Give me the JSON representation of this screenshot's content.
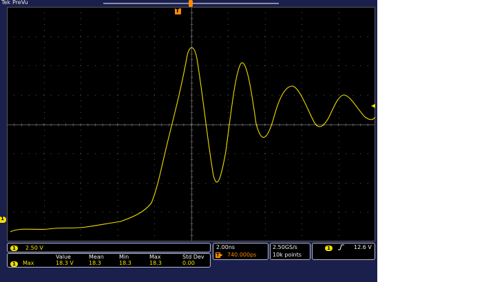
{
  "topbar": {
    "left_icon": "Tek",
    "mode": "PreVu"
  },
  "trigger_marker": "T",
  "channel_marker": "1",
  "scale_panel": {
    "channel": "1",
    "volts_per_div": "2.50 V"
  },
  "measurements": {
    "channel": "1",
    "row_label": "Max",
    "headers": [
      "Value",
      "Mean",
      "Min",
      "Max",
      "Std Dev"
    ],
    "values": [
      "18.3 V",
      "18.3",
      "18.3",
      "18.3",
      "0.00"
    ]
  },
  "timebase": {
    "time_per_div": "2.00ns",
    "trigger_icon": "T",
    "delay": "740.000ps"
  },
  "acquisition": {
    "sample_rate": "2.50GS/s",
    "record_length": "10k points"
  },
  "trigger": {
    "channel": "1",
    "slope_icon": "rising-edge-icon",
    "level": "12.6 V"
  },
  "colors": {
    "trace": "#f0e000",
    "trigger": "#ff8a00",
    "frame": "#1a1f4c",
    "grid": "#5a5a5a"
  }
}
